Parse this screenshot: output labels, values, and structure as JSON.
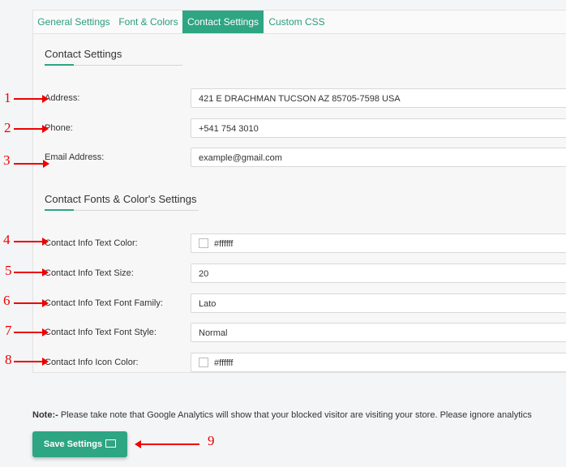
{
  "tabs": [
    {
      "label": "General Settings"
    },
    {
      "label": "Font & Colors"
    },
    {
      "label": "Contact Settings"
    },
    {
      "label": "Custom CSS"
    }
  ],
  "contact_section": {
    "title": "Contact Settings",
    "fields": [
      {
        "num": "1",
        "label": "Address:",
        "value": "421 E DRACHMAN TUCSON AZ 85705-7598 USA"
      },
      {
        "num": "2",
        "label": "Phone:",
        "value": "+541 754 3010"
      },
      {
        "num": "3",
        "label": "Email Address:",
        "value": "example@gmail.com"
      }
    ]
  },
  "style_section": {
    "title": "Contact Fonts & Color's Settings",
    "fields": [
      {
        "num": "4",
        "label": "Contact Info Text Color:",
        "value": "#ffffff"
      },
      {
        "num": "5",
        "label": "Contact Info Text Size:",
        "value": "20"
      },
      {
        "num": "6",
        "label": "Contact Info Text Font Family:",
        "value": "Lato"
      },
      {
        "num": "7",
        "label": "Contact Info Text Font Style:",
        "value": "Normal"
      },
      {
        "num": "8",
        "label": "Contact Info Icon Color:",
        "value": "#ffffff"
      }
    ]
  },
  "note": {
    "prefix": "Note:-",
    "text": " Please take note that Google Analytics will show that your blocked visitor are visiting your store. Please ignore analytics"
  },
  "save_button": {
    "label": "Save Settings",
    "num": "9"
  },
  "colors": {
    "accent": "#2ea583",
    "annotation": "#e00000"
  }
}
